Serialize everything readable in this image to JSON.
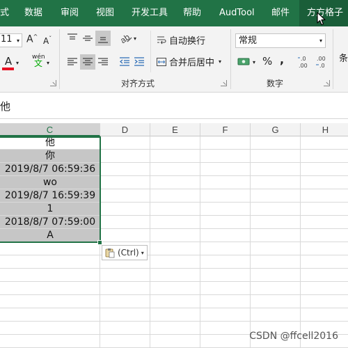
{
  "colors": {
    "accent": "#217346",
    "selection_fill": "#c6c6c6",
    "ribbon_bg": "#f3f3f3"
  },
  "ribbon_tabs": [
    {
      "label": "式",
      "active": false
    },
    {
      "label": "数据",
      "active": false
    },
    {
      "label": "审阅",
      "active": false
    },
    {
      "label": "视图",
      "active": false
    },
    {
      "label": "开发工具",
      "active": false
    },
    {
      "label": "帮助",
      "active": false
    },
    {
      "label": "AudTool",
      "active": false
    },
    {
      "label": "邮件",
      "active": false
    },
    {
      "label": "方方格子",
      "active": true
    }
  ],
  "font_group": {
    "size_value": "11",
    "increase_font_icon": "font-size-increase-icon",
    "decrease_font_icon": "font-size-decrease-icon",
    "font_color_letter": "A",
    "font_color": "#e81123",
    "phonetic_label": "wén"
  },
  "alignment_group": {
    "label": "对齐方式",
    "wrap_text_label": "自动换行",
    "merge_center_label": "合并后居中"
  },
  "number_group": {
    "label": "数字",
    "format_value": "常规",
    "percent_label": "%",
    "comma_label": ",",
    "increase_decimal_label": ".0\n.00",
    "decrease_decimal_label": ".00\n→.0"
  },
  "styles_group": {
    "partial_label": "条"
  },
  "formula_bar": {
    "content": "他"
  },
  "grid": {
    "columns": [
      {
        "label": "C",
        "selected": true
      },
      {
        "label": "D",
        "selected": false
      },
      {
        "label": "E",
        "selected": false
      },
      {
        "label": "F",
        "selected": false
      },
      {
        "label": "G",
        "selected": false
      },
      {
        "label": "H",
        "selected": false
      }
    ],
    "column_c_values": [
      "他",
      "你",
      "2019/8/7  06:59:36",
      "wo",
      "2019/8/7  16:59:39",
      "1",
      "2018/8/7  07:59:00",
      "A"
    ]
  },
  "paste_options": {
    "label": "(Ctrl)",
    "icon": "clipboard-paste-icon"
  },
  "watermark": "CSDN @ffcell2016"
}
